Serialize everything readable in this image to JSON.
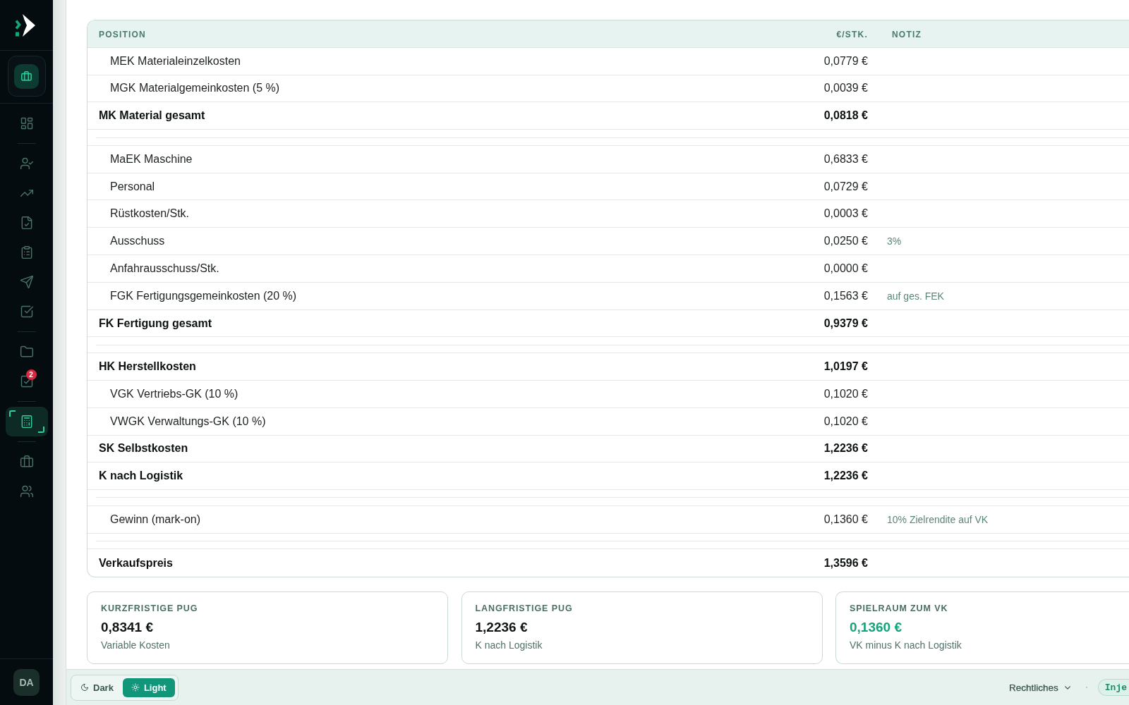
{
  "sidebar": {
    "groups": [
      {
        "items": [
          {
            "kind": "dashboard",
            "selected": false
          }
        ]
      },
      {
        "items": [
          {
            "kind": "user-check",
            "selected": false
          },
          {
            "kind": "trend",
            "selected": false
          },
          {
            "kind": "file-check",
            "selected": false
          },
          {
            "kind": "clipboard",
            "selected": false
          },
          {
            "kind": "send",
            "selected": false
          },
          {
            "kind": "check-square",
            "selected": false
          }
        ]
      },
      {
        "items": [
          {
            "kind": "folder",
            "selected": false
          },
          {
            "kind": "box-check",
            "selected": false,
            "badge": "2"
          }
        ]
      },
      {
        "items": [
          {
            "kind": "calculator",
            "selected": true
          }
        ]
      },
      {
        "items": [
          {
            "kind": "briefcase",
            "selected": false
          },
          {
            "kind": "users",
            "selected": false
          }
        ]
      }
    ],
    "user": {
      "initials": "DA"
    }
  },
  "table": {
    "columns": [
      "POSITION",
      "€/STK.",
      "NOTIZ"
    ],
    "rows": [
      {
        "kind": "item",
        "position": "MEK Materialeinzelkosten",
        "value": "0,0779 €"
      },
      {
        "kind": "item",
        "position": "MGK Materialgemeinkosten (5 %)",
        "value": "0,0039 €"
      },
      {
        "kind": "total",
        "position": "MK Material gesamt",
        "value": "0,0818 €"
      },
      {
        "kind": "spacer"
      },
      {
        "kind": "item",
        "position": "MaEK Maschine",
        "value": "0,6833 €"
      },
      {
        "kind": "item",
        "position": "Personal",
        "value": "0,0729 €"
      },
      {
        "kind": "item",
        "position": "Rüstkosten/Stk.",
        "value": "0,0003 €"
      },
      {
        "kind": "item",
        "position": "Ausschuss",
        "value": "0,0250 €",
        "note": "3%"
      },
      {
        "kind": "item",
        "position": "Anfahrausschuss/Stk.",
        "value": "0,0000 €"
      },
      {
        "kind": "item",
        "position": "FGK Fertigungsgemeinkosten (20 %)",
        "value": "0,1563 €",
        "note": "auf ges. FEK"
      },
      {
        "kind": "total",
        "position": "FK Fertigung gesamt",
        "value": "0,9379 €"
      },
      {
        "kind": "spacer"
      },
      {
        "kind": "total",
        "position": "HK Herstellkosten",
        "value": "1,0197 €"
      },
      {
        "kind": "item",
        "position": "VGK Vertriebs-GK (10 %)",
        "value": "0,1020 €"
      },
      {
        "kind": "item",
        "position": "VWGK Verwaltungs-GK (10 %)",
        "value": "0,1020 €"
      },
      {
        "kind": "total",
        "position": "SK Selbstkosten",
        "value": "1,2236 €"
      },
      {
        "kind": "total",
        "position": "K nach Logistik",
        "value": "1,2236 €"
      },
      {
        "kind": "spacer"
      },
      {
        "kind": "item",
        "position": "Gewinn (mark-on)",
        "value": "0,1360 €",
        "note": "10% Zielrendite auf VK"
      },
      {
        "kind": "spacer"
      },
      {
        "kind": "total",
        "position": "Verkaufspreis",
        "value": "1,3596 €"
      }
    ]
  },
  "summary_cards": [
    {
      "kind": "plain",
      "title": "KURZFRISTIGE PUG",
      "value": "0,8341 €",
      "caption": "Variable Kosten"
    },
    {
      "kind": "plain",
      "title": "LANGFRISTIGE PUG",
      "value": "1,2236 €",
      "caption": "K nach Logistik"
    },
    {
      "kind": "highlight",
      "title": "SPIELRAUM ZUM VK",
      "value": "0,1360 €",
      "caption": "VK minus K nach Logistik"
    }
  ],
  "footer": {
    "theme_toggle": [
      {
        "kind": "dark",
        "label": "Dark",
        "selected": false
      },
      {
        "kind": "light",
        "label": "Light",
        "selected": true
      }
    ],
    "legal_menu": {
      "label": "Rechtliches"
    },
    "tag": "Inje"
  }
}
